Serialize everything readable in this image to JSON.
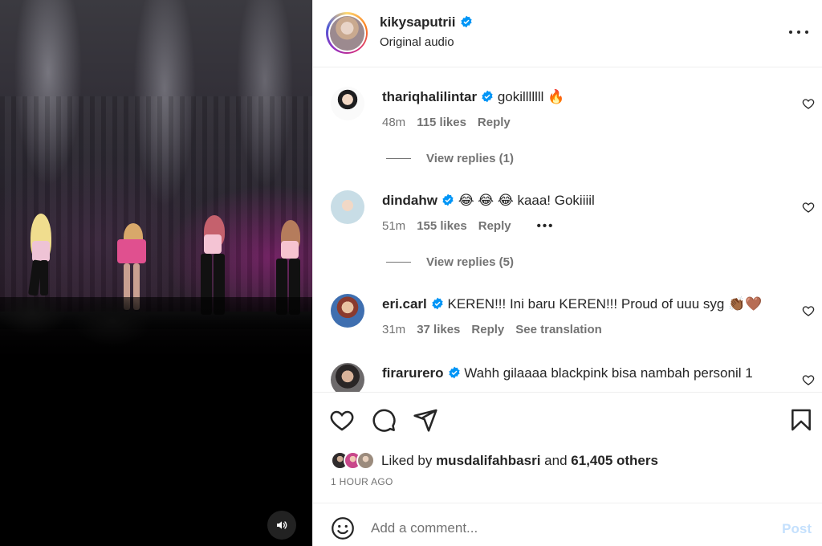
{
  "media": {
    "sound_icon": "speaker-icon"
  },
  "header": {
    "username": "kikysaputrii",
    "subtitle": "Original audio",
    "more_icon": "more-horizontal-icon"
  },
  "comments": [
    {
      "user": "thariqhalilintar",
      "verified": true,
      "text": "gokilllllll 🔥",
      "time": "48m",
      "likes": "115 likes",
      "reply": "Reply",
      "view_replies": "View replies (1)"
    },
    {
      "user": "dindahw",
      "verified": true,
      "text": "😂 😂 😂 kaaa! Gokiiiil",
      "time": "51m",
      "likes": "155 likes",
      "reply": "Reply",
      "extra": "•••",
      "view_replies": "View replies (5)"
    },
    {
      "user": "eri.carl",
      "verified": true,
      "text": "KEREN!!! Ini baru KEREN!!! Proud of uuu syg 👏🏾🤎",
      "time": "31m",
      "likes": "37 likes",
      "reply": "Reply",
      "see_translation": "See translation"
    },
    {
      "user": "firarurero",
      "verified": true,
      "text": "Wahh gilaaaa blackpink bisa nambah personil 1"
    }
  ],
  "actions": {
    "like_icon": "heart-icon",
    "comment_icon": "comment-icon",
    "share_icon": "send-icon",
    "save_icon": "bookmark-icon",
    "liked_by_prefix": "Liked by",
    "liked_by_user": "musdalifahbasri",
    "liked_by_and": "and",
    "liked_by_others": "61,405 others",
    "timestamp": "1 HOUR AGO"
  },
  "add_comment": {
    "placeholder": "Add a comment...",
    "post_label": "Post",
    "emoji_icon": "smiley-icon"
  },
  "colors": {
    "verified": "#0095f6",
    "muted_text": "#737373",
    "post_disabled": "#c4e0fd"
  }
}
